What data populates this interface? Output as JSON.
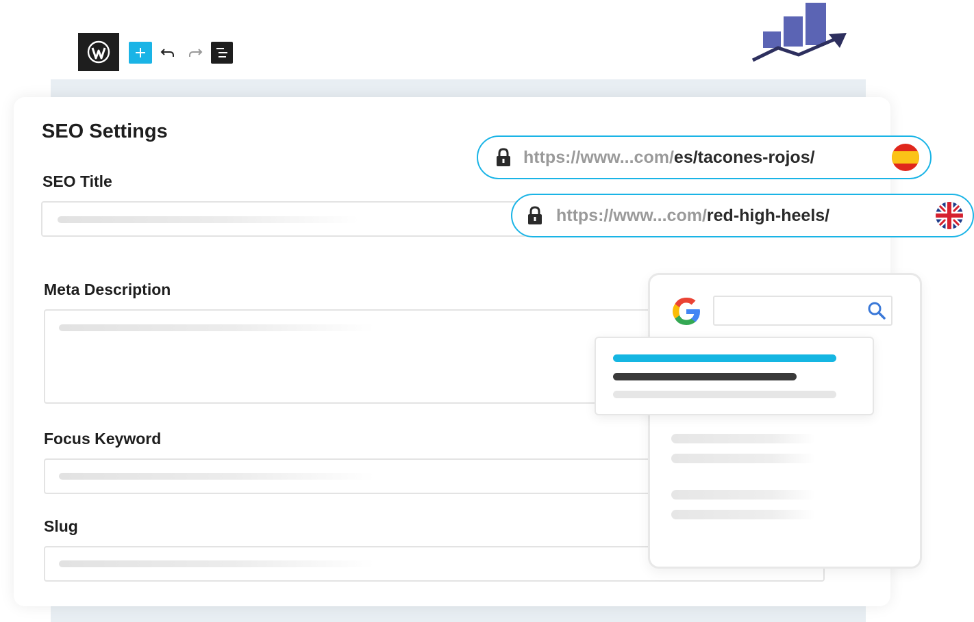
{
  "toolbar": {
    "wordpress_icon": "wordpress-logo-icon",
    "add_icon": "plus-icon",
    "undo_icon": "undo-arrow-icon",
    "redo_icon": "redo-arrow-icon",
    "outline_icon": "list-outline-icon"
  },
  "brand": {
    "icon": "bar-chart-growth-arrow-icon",
    "color": "#5b64b4"
  },
  "seo_panel": {
    "title": "SEO Settings",
    "fields": [
      {
        "label": "SEO Title",
        "value": ""
      },
      {
        "label": "Meta Description",
        "value": ""
      },
      {
        "label": "Focus Keyword",
        "value": ""
      },
      {
        "label": "Slug",
        "value": ""
      }
    ]
  },
  "url_pills": [
    {
      "base": "https://www...com/",
      "path": "es/tacones-rojos/",
      "flag": "spain-flag-icon"
    },
    {
      "base": "https://www...com/",
      "path": "red-high-heels/",
      "flag": "uk-flag-icon"
    }
  ],
  "google_preview": {
    "logo_icon": "google-logo-icon",
    "search_icon": "magnifier-icon",
    "search_value": ""
  },
  "colors": {
    "accent": "#1ab4e6",
    "dark": "#1e1e1e",
    "band": "#e8eef3",
    "result_title": "#15b6e2",
    "result_url": "#3a3a3a"
  }
}
